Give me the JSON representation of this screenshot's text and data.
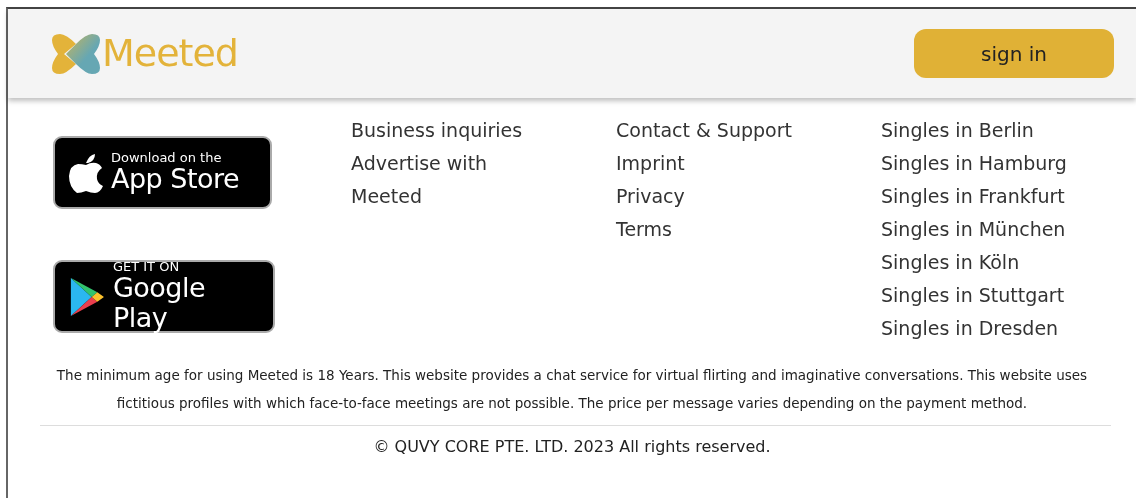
{
  "header": {
    "logo_text": "Meeted",
    "sign_in": "sign in"
  },
  "badges": [
    {
      "kind": "apple",
      "small": "Download on the",
      "big": "App Store"
    },
    {
      "kind": "google",
      "small": "GET IT ON",
      "big": "Google Play"
    }
  ],
  "link_columns": [
    [
      "Business inquiries",
      "Advertise with Meeted"
    ],
    [
      "Contact & Support",
      "Imprint",
      "Privacy",
      "Terms"
    ],
    [
      "Singles in Berlin",
      "Singles in Hamburg",
      "Singles in Frankfurt",
      "Singles in München",
      "Singles in Köln",
      "Singles in Stuttgart",
      "Singles in Dresden"
    ]
  ],
  "disclaimer": "The minimum age for using Meeted is 18 Years. This website provides a chat service for virtual flirting and imaginative conversations. This website uses fictitious profiles with which face-to-face meetings are not possible. The price per message varies depending on the payment method.",
  "copyright": "© QUVY CORE PTE. LTD. 2023 All rights reserved."
}
